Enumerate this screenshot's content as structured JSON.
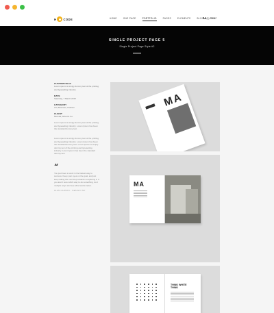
{
  "window": {
    "controls": [
      "close",
      "minimize",
      "maximize"
    ]
  },
  "header": {
    "logo_left": "H",
    "logo_right": "CODE",
    "nav": [
      {
        "label": "HOME",
        "active": false
      },
      {
        "label": "ONE PAGE",
        "active": false
      },
      {
        "label": "PORTFOLIO",
        "active": true
      },
      {
        "label": "PAGES",
        "active": false
      },
      {
        "label": "ELEMENTS",
        "active": false
      },
      {
        "label": "BLOG",
        "active": false
      },
      {
        "label": "SHOP",
        "active": false
      }
    ],
    "cart": "(0) ITEM"
  },
  "hero": {
    "title": "SINGLE PROJECT PAGE 5",
    "subtitle": "Single Project Page Style #2"
  },
  "sidebar": {
    "meta": [
      {
        "label": "CUSTOM FIELD",
        "value": "Lorem ipsum is simply dummy text of the printing and typesetting industry."
      },
      {
        "label": "DATE",
        "value": "Saturday, 7 March 2015"
      },
      {
        "label": "CATEGORY",
        "value": "Art, Business, Fashion"
      },
      {
        "label": "CLIENT",
        "value": "Moretta, Alfred & Co."
      }
    ],
    "paragraphs": [
      "Lorem ipsum is simply dummy text of the printing and typesetting industry. Lorem Ipsum has been the standard dummy text.",
      "Lorem ipsum is simply dummy text of the printing and typesetting industry. Lorem Ipsum has been the standard dummy text. Lorem ipsum is simply dummy text of the printing and typesetting industry. Lorem Ipsum has been the standard dummy text."
    ],
    "quote_mark": "“",
    "quote": "You just have to work in the fastest way to success. Keep your eyes on the goal, and just keep taking the next step towards completing it. If you aren't sure which way to do something, do it multiple ways and see what works better.",
    "quote_author": "ALAN CARSON - DESIGN INC"
  },
  "gallery": {
    "mag_title": "MA",
    "spread_title": "MA",
    "book_title": "THINK WHITE\nTHINK"
  },
  "colors": {
    "accent": "#f2b21b",
    "hero_bg": "#050505",
    "page_bg": "#f5f5f5"
  }
}
